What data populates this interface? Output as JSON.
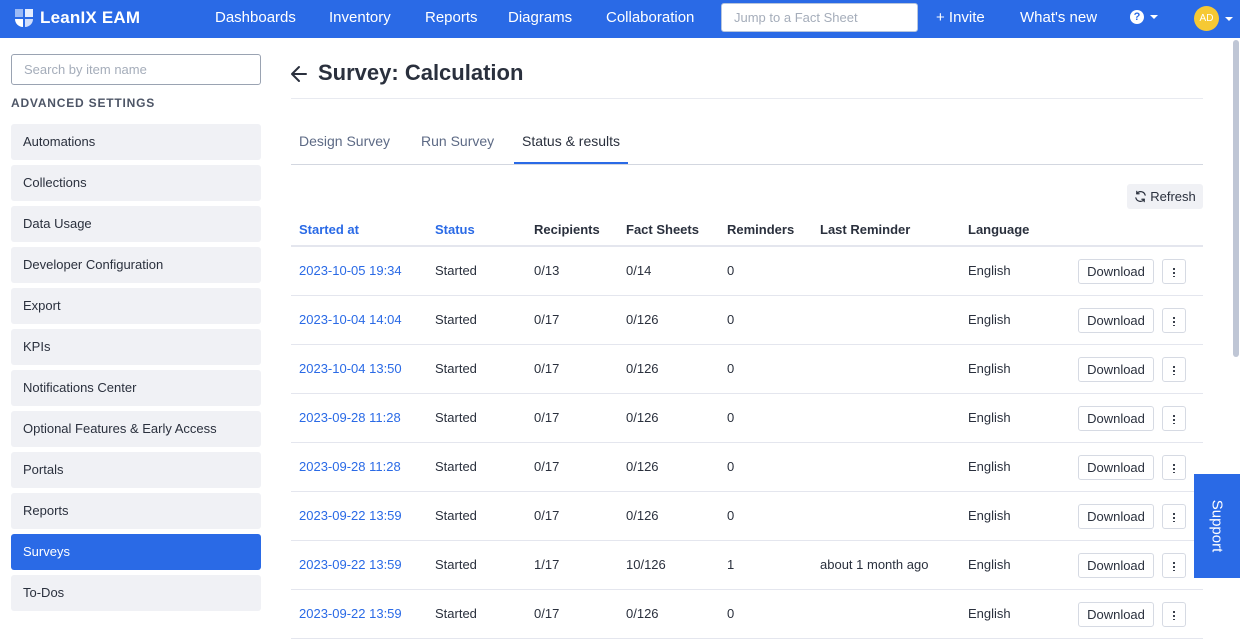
{
  "app": {
    "brand": "LeanIX EAM",
    "nav": [
      "Dashboards",
      "Inventory",
      "Reports",
      "Diagrams",
      "Collaboration"
    ],
    "jump_placeholder": "Jump to a Fact Sheet",
    "invite": "+ Invite",
    "whats_new": "What's new",
    "help_icon": "question-circle-icon",
    "avatar_initials": "AD",
    "brand_color": "#2a6ae6",
    "avatar_color": "#f6c934"
  },
  "sidebar": {
    "search_placeholder": "Search by item name",
    "heading": "ADVANCED SETTINGS",
    "items": [
      {
        "label": "Automations",
        "active": false
      },
      {
        "label": "Collections",
        "active": false
      },
      {
        "label": "Data Usage",
        "active": false
      },
      {
        "label": "Developer Configuration",
        "active": false
      },
      {
        "label": "Export",
        "active": false
      },
      {
        "label": "KPIs",
        "active": false
      },
      {
        "label": "Notifications Center",
        "active": false
      },
      {
        "label": "Optional Features & Early Access",
        "active": false
      },
      {
        "label": "Portals",
        "active": false
      },
      {
        "label": "Reports",
        "active": false
      },
      {
        "label": "Surveys",
        "active": true
      },
      {
        "label": "To-Dos",
        "active": false
      }
    ]
  },
  "page": {
    "title": "Survey: Calculation",
    "tabs": [
      {
        "label": "Design Survey",
        "active": false
      },
      {
        "label": "Run Survey",
        "active": false
      },
      {
        "label": "Status & results",
        "active": true
      }
    ],
    "refresh_label": "Refresh"
  },
  "table": {
    "columns": [
      "Started at",
      "Status",
      "Recipients",
      "Fact Sheets",
      "Reminders",
      "Last Reminder",
      "Language"
    ],
    "download_label": "Download",
    "rows": [
      {
        "started_at": "2023-10-05 19:34",
        "status": "Started",
        "recipients": "0/13",
        "fact_sheets": "0/14",
        "reminders": "0",
        "last_reminder": "",
        "language": "English"
      },
      {
        "started_at": "2023-10-04 14:04",
        "status": "Started",
        "recipients": "0/17",
        "fact_sheets": "0/126",
        "reminders": "0",
        "last_reminder": "",
        "language": "English"
      },
      {
        "started_at": "2023-10-04 13:50",
        "status": "Started",
        "recipients": "0/17",
        "fact_sheets": "0/126",
        "reminders": "0",
        "last_reminder": "",
        "language": "English"
      },
      {
        "started_at": "2023-09-28 11:28",
        "status": "Started",
        "recipients": "0/17",
        "fact_sheets": "0/126",
        "reminders": "0",
        "last_reminder": "",
        "language": "English"
      },
      {
        "started_at": "2023-09-28 11:28",
        "status": "Started",
        "recipients": "0/17",
        "fact_sheets": "0/126",
        "reminders": "0",
        "last_reminder": "",
        "language": "English"
      },
      {
        "started_at": "2023-09-22 13:59",
        "status": "Started",
        "recipients": "0/17",
        "fact_sheets": "0/126",
        "reminders": "0",
        "last_reminder": "",
        "language": "English"
      },
      {
        "started_at": "2023-09-22 13:59",
        "status": "Started",
        "recipients": "1/17",
        "fact_sheets": "10/126",
        "reminders": "1",
        "last_reminder": "about 1 month ago",
        "language": "English"
      },
      {
        "started_at": "2023-09-22 13:59",
        "status": "Started",
        "recipients": "0/17",
        "fact_sheets": "0/126",
        "reminders": "0",
        "last_reminder": "",
        "language": "English"
      }
    ]
  },
  "support_label": "Support"
}
